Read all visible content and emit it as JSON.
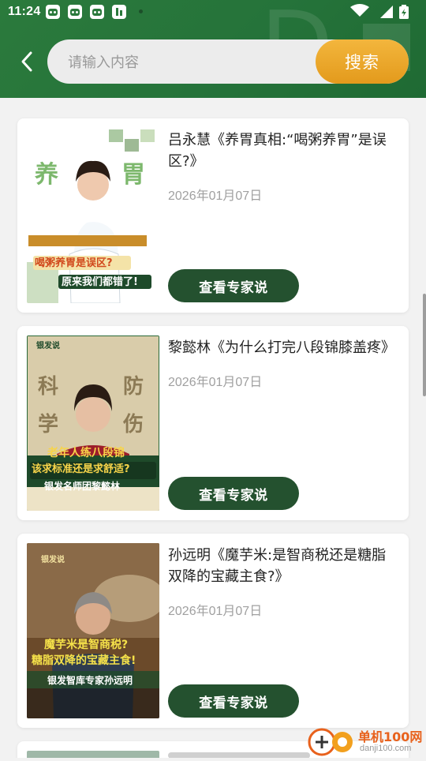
{
  "status_bar": {
    "time": "11:24",
    "icons": [
      "app-notification-icon",
      "app-notification-icon",
      "app-notification-icon",
      "app-badge-icon",
      "dot-icon"
    ],
    "right_icons": [
      "wifi-icon",
      "cellular-signal-icon",
      "battery-icon"
    ]
  },
  "header": {
    "back_icon": "chevron-left-icon",
    "search": {
      "placeholder": "请输入内容",
      "value": "",
      "button_label": "搜索"
    },
    "colors": {
      "header_green": "#2b7a3c",
      "search_button": "#f0ad33"
    }
  },
  "articles": [
    {
      "title": "吕永慧《养胃真相:“喝粥养胃”是误区?》",
      "date": "2026年01月07日",
      "button_label": "查看专家说",
      "thumbnail": {
        "title_chars": [
          "养",
          "胃"
        ],
        "caption_top": "喝粥养胃是误区?",
        "caption_bottom": "原来我们都错了!"
      }
    },
    {
      "title": "黎懿林《为什么打完八段锦膝盖疼》",
      "date": "2026年01月07日",
      "button_label": "查看专家说",
      "thumbnail": {
        "brand": "银发说",
        "title_chars": [
          "科",
          "学",
          "防",
          "伤"
        ],
        "caption_top": "老年人练八段锦",
        "caption_mid": "该求标准还是求舒适?",
        "caption_bottom": "银发名师团黎懿林"
      }
    },
    {
      "title": "孙远明《魔芋米:是智商税还是糖脂双降的宝藏主食?》",
      "date": "2026年01月07日",
      "button_label": "查看专家说",
      "thumbnail": {
        "brand": "银发说",
        "caption_top": "魔芋米是智商税?",
        "caption_mid": "糖脂双降的宝藏主食!",
        "caption_bottom": "银发智库专家孙远明"
      }
    }
  ],
  "watermark": {
    "text": "单机100网",
    "sub": "danji100.com"
  },
  "colors": {
    "button_dark_green": "#24512f",
    "date_gray": "#a0a0a0",
    "background": "#f2f2f2"
  }
}
